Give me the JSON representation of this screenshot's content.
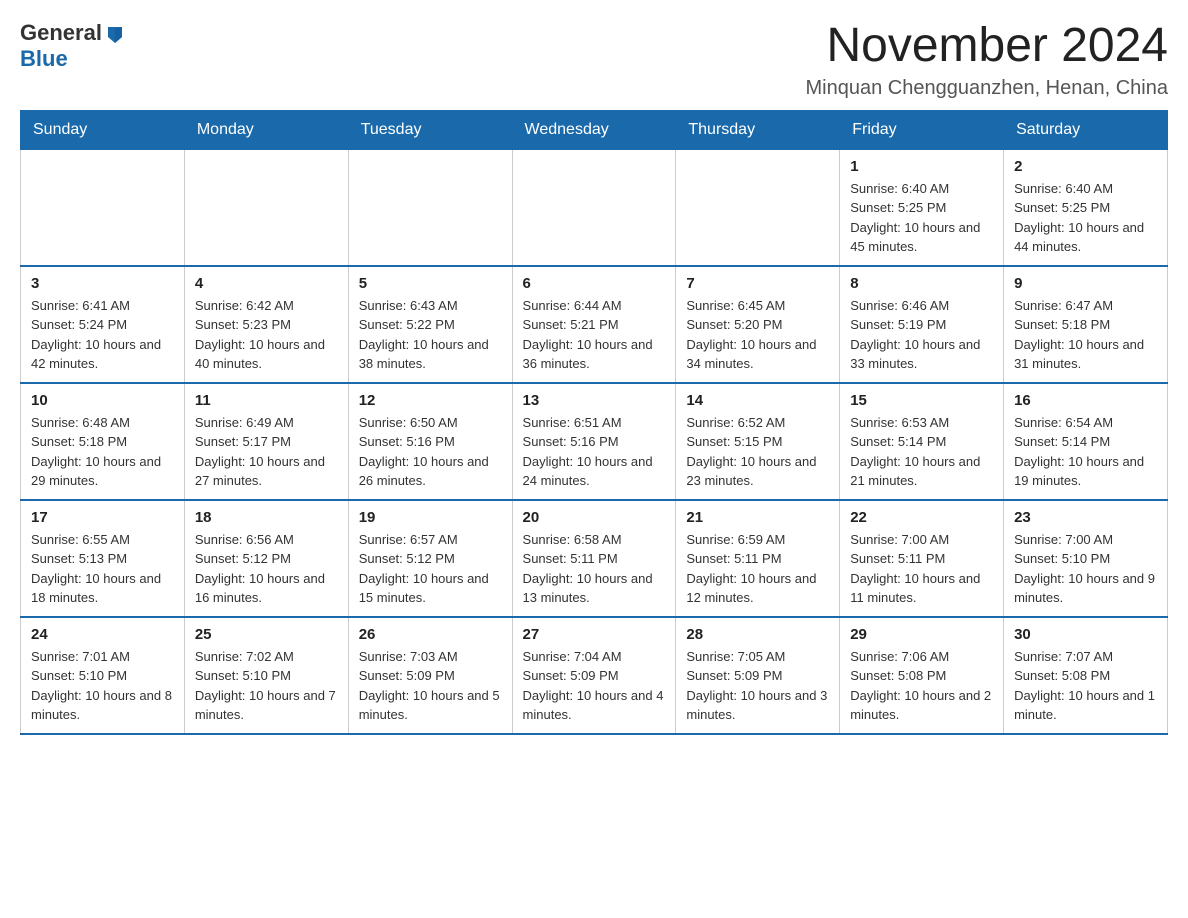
{
  "logo": {
    "general": "General",
    "blue": "Blue"
  },
  "title": "November 2024",
  "location": "Minquan Chengguanzhen, Henan, China",
  "weekdays": [
    "Sunday",
    "Monday",
    "Tuesday",
    "Wednesday",
    "Thursday",
    "Friday",
    "Saturday"
  ],
  "weeks": [
    [
      {
        "day": "",
        "info": ""
      },
      {
        "day": "",
        "info": ""
      },
      {
        "day": "",
        "info": ""
      },
      {
        "day": "",
        "info": ""
      },
      {
        "day": "",
        "info": ""
      },
      {
        "day": "1",
        "info": "Sunrise: 6:40 AM\nSunset: 5:25 PM\nDaylight: 10 hours and 45 minutes."
      },
      {
        "day": "2",
        "info": "Sunrise: 6:40 AM\nSunset: 5:25 PM\nDaylight: 10 hours and 44 minutes."
      }
    ],
    [
      {
        "day": "3",
        "info": "Sunrise: 6:41 AM\nSunset: 5:24 PM\nDaylight: 10 hours and 42 minutes."
      },
      {
        "day": "4",
        "info": "Sunrise: 6:42 AM\nSunset: 5:23 PM\nDaylight: 10 hours and 40 minutes."
      },
      {
        "day": "5",
        "info": "Sunrise: 6:43 AM\nSunset: 5:22 PM\nDaylight: 10 hours and 38 minutes."
      },
      {
        "day": "6",
        "info": "Sunrise: 6:44 AM\nSunset: 5:21 PM\nDaylight: 10 hours and 36 minutes."
      },
      {
        "day": "7",
        "info": "Sunrise: 6:45 AM\nSunset: 5:20 PM\nDaylight: 10 hours and 34 minutes."
      },
      {
        "day": "8",
        "info": "Sunrise: 6:46 AM\nSunset: 5:19 PM\nDaylight: 10 hours and 33 minutes."
      },
      {
        "day": "9",
        "info": "Sunrise: 6:47 AM\nSunset: 5:18 PM\nDaylight: 10 hours and 31 minutes."
      }
    ],
    [
      {
        "day": "10",
        "info": "Sunrise: 6:48 AM\nSunset: 5:18 PM\nDaylight: 10 hours and 29 minutes."
      },
      {
        "day": "11",
        "info": "Sunrise: 6:49 AM\nSunset: 5:17 PM\nDaylight: 10 hours and 27 minutes."
      },
      {
        "day": "12",
        "info": "Sunrise: 6:50 AM\nSunset: 5:16 PM\nDaylight: 10 hours and 26 minutes."
      },
      {
        "day": "13",
        "info": "Sunrise: 6:51 AM\nSunset: 5:16 PM\nDaylight: 10 hours and 24 minutes."
      },
      {
        "day": "14",
        "info": "Sunrise: 6:52 AM\nSunset: 5:15 PM\nDaylight: 10 hours and 23 minutes."
      },
      {
        "day": "15",
        "info": "Sunrise: 6:53 AM\nSunset: 5:14 PM\nDaylight: 10 hours and 21 minutes."
      },
      {
        "day": "16",
        "info": "Sunrise: 6:54 AM\nSunset: 5:14 PM\nDaylight: 10 hours and 19 minutes."
      }
    ],
    [
      {
        "day": "17",
        "info": "Sunrise: 6:55 AM\nSunset: 5:13 PM\nDaylight: 10 hours and 18 minutes."
      },
      {
        "day": "18",
        "info": "Sunrise: 6:56 AM\nSunset: 5:12 PM\nDaylight: 10 hours and 16 minutes."
      },
      {
        "day": "19",
        "info": "Sunrise: 6:57 AM\nSunset: 5:12 PM\nDaylight: 10 hours and 15 minutes."
      },
      {
        "day": "20",
        "info": "Sunrise: 6:58 AM\nSunset: 5:11 PM\nDaylight: 10 hours and 13 minutes."
      },
      {
        "day": "21",
        "info": "Sunrise: 6:59 AM\nSunset: 5:11 PM\nDaylight: 10 hours and 12 minutes."
      },
      {
        "day": "22",
        "info": "Sunrise: 7:00 AM\nSunset: 5:11 PM\nDaylight: 10 hours and 11 minutes."
      },
      {
        "day": "23",
        "info": "Sunrise: 7:00 AM\nSunset: 5:10 PM\nDaylight: 10 hours and 9 minutes."
      }
    ],
    [
      {
        "day": "24",
        "info": "Sunrise: 7:01 AM\nSunset: 5:10 PM\nDaylight: 10 hours and 8 minutes."
      },
      {
        "day": "25",
        "info": "Sunrise: 7:02 AM\nSunset: 5:10 PM\nDaylight: 10 hours and 7 minutes."
      },
      {
        "day": "26",
        "info": "Sunrise: 7:03 AM\nSunset: 5:09 PM\nDaylight: 10 hours and 5 minutes."
      },
      {
        "day": "27",
        "info": "Sunrise: 7:04 AM\nSunset: 5:09 PM\nDaylight: 10 hours and 4 minutes."
      },
      {
        "day": "28",
        "info": "Sunrise: 7:05 AM\nSunset: 5:09 PM\nDaylight: 10 hours and 3 minutes."
      },
      {
        "day": "29",
        "info": "Sunrise: 7:06 AM\nSunset: 5:08 PM\nDaylight: 10 hours and 2 minutes."
      },
      {
        "day": "30",
        "info": "Sunrise: 7:07 AM\nSunset: 5:08 PM\nDaylight: 10 hours and 1 minute."
      }
    ]
  ]
}
